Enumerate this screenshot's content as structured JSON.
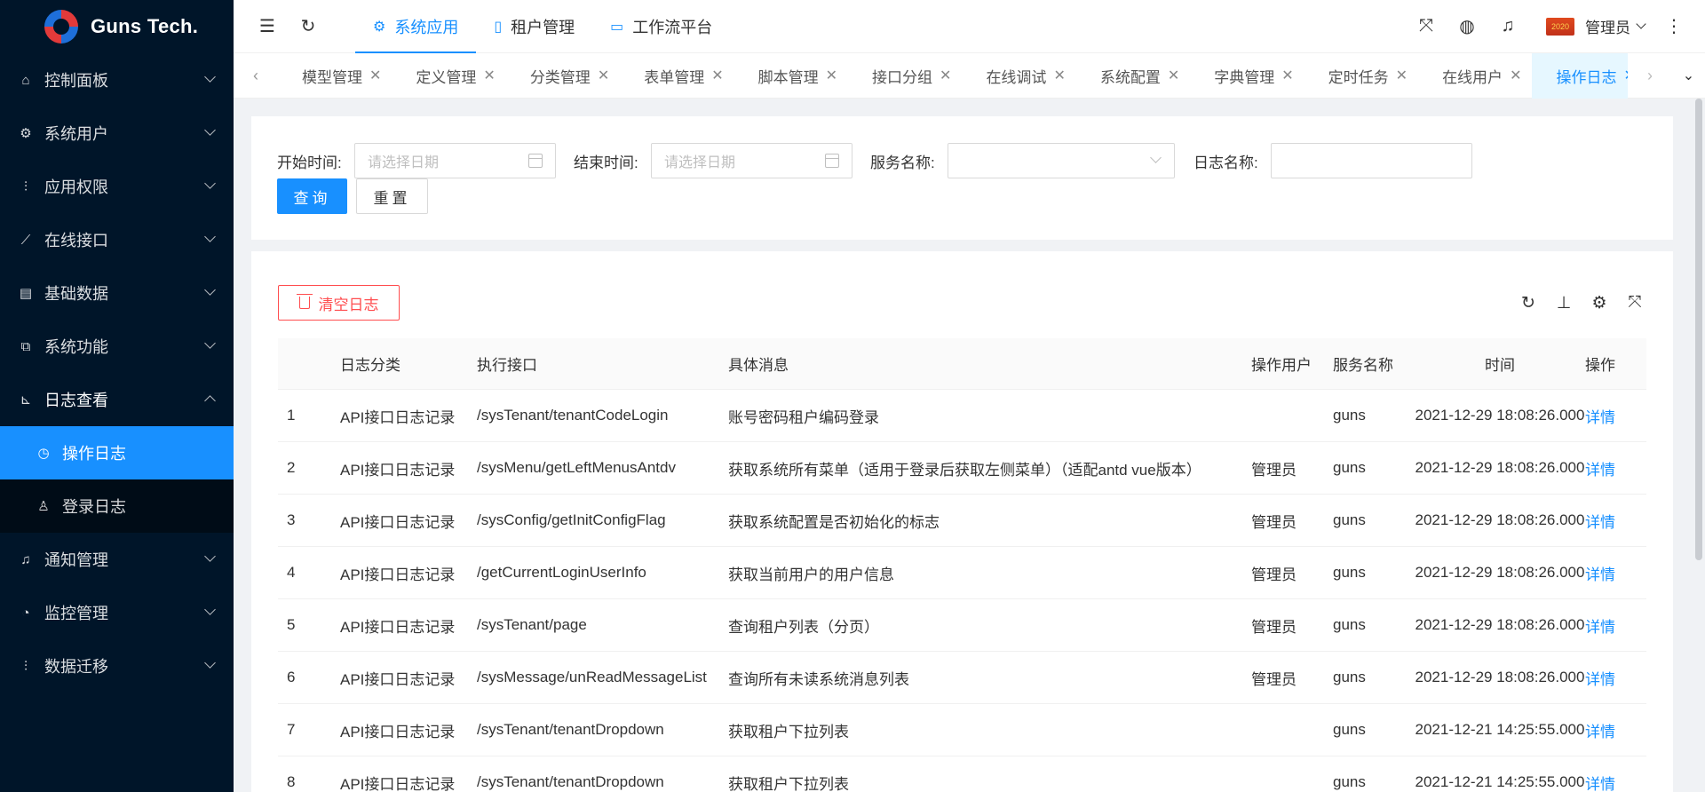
{
  "brand": {
    "name": "Guns Tech."
  },
  "sidebar": {
    "items": [
      {
        "label": "控制面板",
        "icon": "home-icon"
      },
      {
        "label": "系统用户",
        "icon": "gear-icon"
      },
      {
        "label": "应用权限",
        "icon": "sliders-icon"
      },
      {
        "label": "在线接口",
        "icon": "leaf-icon"
      },
      {
        "label": "基础数据",
        "icon": "database-icon"
      },
      {
        "label": "系统功能",
        "icon": "cluster-icon"
      },
      {
        "label": "日志查看",
        "icon": "chart-icon"
      },
      {
        "label": "通知管理",
        "icon": "bell-icon"
      },
      {
        "label": "监控管理",
        "icon": "dashboard-icon"
      },
      {
        "label": "数据迁移",
        "icon": "sliders-icon"
      }
    ],
    "sub_items": [
      {
        "label": "操作日志",
        "icon": "clock-icon"
      },
      {
        "label": "登录日志",
        "icon": "user-icon"
      }
    ]
  },
  "header": {
    "nav": [
      {
        "label": "系统应用",
        "icon": "gear-icon"
      },
      {
        "label": "租户管理",
        "icon": "book-icon"
      },
      {
        "label": "工作流平台",
        "icon": "id-card-icon"
      }
    ],
    "user_name": "管理员",
    "avatar_text": "2020"
  },
  "tabs": [
    "模型管理",
    "定义管理",
    "分类管理",
    "表单管理",
    "脚本管理",
    "接口分组",
    "在线调试",
    "系统配置",
    "字典管理",
    "定时任务",
    "在线用户",
    "操作日志"
  ],
  "search": {
    "start_label": "开始时间:",
    "start_placeholder": "请选择日期",
    "end_label": "结束时间:",
    "end_placeholder": "请选择日期",
    "service_label": "服务名称:",
    "log_name_label": "日志名称:",
    "query_label": "查询",
    "reset_label": "重置"
  },
  "toolbar": {
    "clear_label": "清空日志"
  },
  "table": {
    "columns": [
      "",
      "日志分类",
      "执行接口",
      "具体消息",
      "操作用户",
      "服务名称",
      "时间",
      "操作"
    ],
    "rows": [
      [
        "1",
        "API接口日志记录",
        "/sysTenant/tenantCodeLogin",
        "账号密码租户编码登录",
        "",
        "guns",
        "2021-12-29 18:08:26.000",
        "详情"
      ],
      [
        "2",
        "API接口日志记录",
        "/sysMenu/getLeftMenusAntdv",
        "获取系统所有菜单（适用于登录后获取左侧菜单）（适配antd vue版本）",
        "管理员",
        "guns",
        "2021-12-29 18:08:26.000",
        "详情"
      ],
      [
        "3",
        "API接口日志记录",
        "/sysConfig/getInitConfigFlag",
        "获取系统配置是否初始化的标志",
        "管理员",
        "guns",
        "2021-12-29 18:08:26.000",
        "详情"
      ],
      [
        "4",
        "API接口日志记录",
        "/getCurrentLoginUserInfo",
        "获取当前用户的用户信息",
        "管理员",
        "guns",
        "2021-12-29 18:08:26.000",
        "详情"
      ],
      [
        "5",
        "API接口日志记录",
        "/sysTenant/page",
        "查询租户列表（分页）",
        "管理员",
        "guns",
        "2021-12-29 18:08:26.000",
        "详情"
      ],
      [
        "6",
        "API接口日志记录",
        "/sysMessage/unReadMessageList",
        "查询所有未读系统消息列表",
        "管理员",
        "guns",
        "2021-12-29 18:08:26.000",
        "详情"
      ],
      [
        "7",
        "API接口日志记录",
        "/sysTenant/tenantDropdown",
        "获取租户下拉列表",
        "",
        "guns",
        "2021-12-21 14:25:55.000",
        "详情"
      ],
      [
        "8",
        "API接口日志记录",
        "/sysTenant/tenantDropdown",
        "获取租户下拉列表",
        "",
        "guns",
        "2021-12-21 14:25:55.000",
        "详情"
      ]
    ]
  },
  "colors": {
    "primary": "#1890ff",
    "sidebar_bg": "#001529",
    "danger": "#ff4d4f"
  }
}
